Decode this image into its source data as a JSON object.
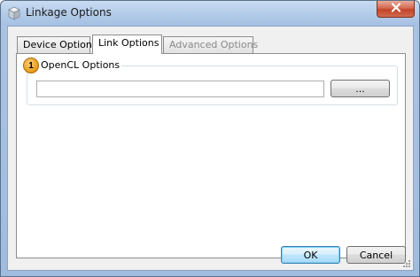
{
  "window": {
    "title": "Linkage Options",
    "close_icon": "close-icon",
    "app_icon": "cube-icon"
  },
  "tabs": [
    {
      "label": "Device Options",
      "state": "normal"
    },
    {
      "label": "Link Options",
      "state": "active"
    },
    {
      "label": "Advanced Options",
      "state": "disabled"
    }
  ],
  "opencl": {
    "badge": "1",
    "group_label": "OpenCL Options",
    "path_value": "",
    "browse_label": "..."
  },
  "footer": {
    "ok_label": "OK",
    "cancel_label": "Cancel"
  },
  "colors": {
    "close_button": "#c4432a",
    "badge": "#e89a16",
    "default_button_border": "#3c7fb1"
  }
}
